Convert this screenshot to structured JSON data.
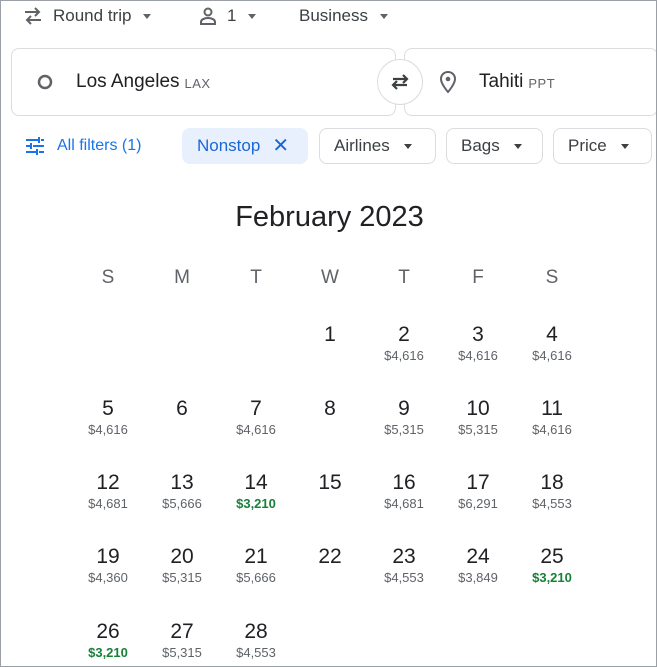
{
  "options": {
    "trip_type": "Round trip",
    "passengers": "1",
    "cabin": "Business"
  },
  "origin": {
    "city": "Los Angeles",
    "code": "LAX"
  },
  "destination": {
    "city": "Tahiti",
    "code": "PPT"
  },
  "filters": {
    "all_filters": "All filters (1)",
    "nonstop": "Nonstop",
    "airlines": "Airlines",
    "bags": "Bags",
    "price": "Price"
  },
  "calendar": {
    "month": "February 2023",
    "weekdays": [
      "S",
      "M",
      "T",
      "W",
      "T",
      "F",
      "S"
    ],
    "low_price_color": "#188038",
    "days": [
      {
        "day": "1",
        "price": ""
      },
      {
        "day": "2",
        "price": "$4,616"
      },
      {
        "day": "3",
        "price": "$4,616"
      },
      {
        "day": "4",
        "price": "$4,616"
      },
      {
        "day": "5",
        "price": "$4,616"
      },
      {
        "day": "6",
        "price": ""
      },
      {
        "day": "7",
        "price": "$4,616"
      },
      {
        "day": "8",
        "price": ""
      },
      {
        "day": "9",
        "price": "$5,315"
      },
      {
        "day": "10",
        "price": "$5,315"
      },
      {
        "day": "11",
        "price": "$4,616"
      },
      {
        "day": "12",
        "price": "$4,681"
      },
      {
        "day": "13",
        "price": "$5,666"
      },
      {
        "day": "14",
        "price": "$3,210",
        "low": true
      },
      {
        "day": "15",
        "price": ""
      },
      {
        "day": "16",
        "price": "$4,681"
      },
      {
        "day": "17",
        "price": "$6,291"
      },
      {
        "day": "18",
        "price": "$4,553"
      },
      {
        "day": "19",
        "price": "$4,360"
      },
      {
        "day": "20",
        "price": "$5,315"
      },
      {
        "day": "21",
        "price": "$5,666"
      },
      {
        "day": "22",
        "price": ""
      },
      {
        "day": "23",
        "price": "$4,553"
      },
      {
        "day": "24",
        "price": "$3,849"
      },
      {
        "day": "25",
        "price": "$3,210",
        "low": true
      },
      {
        "day": "26",
        "price": "$3,210",
        "low": true
      },
      {
        "day": "27",
        "price": "$5,315"
      },
      {
        "day": "28",
        "price": "$4,553"
      }
    ]
  }
}
